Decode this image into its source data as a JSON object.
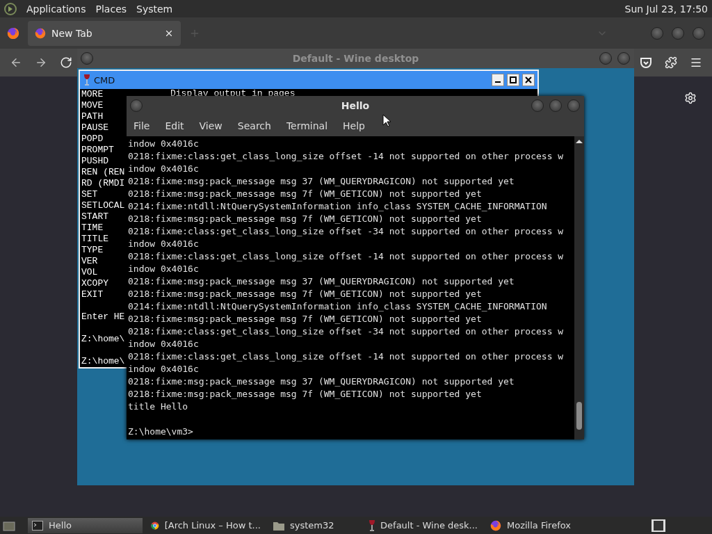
{
  "top_panel": {
    "menus": [
      "Applications",
      "Places",
      "System"
    ],
    "clock": "Sun Jul 23, 17:50"
  },
  "browser": {
    "tabs": [
      {
        "label": "New Tab",
        "selected": true
      }
    ]
  },
  "wine_desktop": {
    "title": "Default - Wine desktop"
  },
  "cmd_window": {
    "title": "CMD",
    "description": "Display output in pages",
    "lines": [
      {
        "text": "MORE",
        "gap_before": false
      },
      {
        "text": "MOVE",
        "gap_before": false
      },
      {
        "text": "PATH",
        "gap_before": false
      },
      {
        "text": "PAUSE",
        "gap_before": false
      },
      {
        "text": "POPD",
        "gap_before": false
      },
      {
        "text": "PROMPT",
        "gap_before": false
      },
      {
        "text": "PUSHD",
        "gap_before": false
      },
      {
        "text": "REN (REN",
        "gap_before": false
      },
      {
        "text": "RD (RMDI",
        "gap_before": false
      },
      {
        "text": "SET",
        "gap_before": false
      },
      {
        "text": "SETLOCAL",
        "gap_before": false
      },
      {
        "text": "START",
        "gap_before": false
      },
      {
        "text": "TIME",
        "gap_before": false
      },
      {
        "text": "TITLE",
        "gap_before": false
      },
      {
        "text": "TYPE",
        "gap_before": false
      },
      {
        "text": "VER",
        "gap_before": false
      },
      {
        "text": "VOL",
        "gap_before": false
      },
      {
        "text": "XCOPY",
        "gap_before": false
      },
      {
        "text": "EXIT",
        "gap_before": false
      },
      {
        "text": "Enter HE",
        "gap_before": true
      },
      {
        "text": "Z:\\home\\",
        "gap_before": true
      },
      {
        "text": "Z:\\home\\",
        "gap_before": true
      }
    ]
  },
  "terminal": {
    "title": "Hello",
    "menu": [
      "File",
      "Edit",
      "View",
      "Search",
      "Terminal",
      "Help"
    ],
    "lines": [
      "indow 0x4016c",
      "0218:fixme:class:get_class_long_size offset -14 not supported on other process w",
      "indow 0x4016c",
      "0218:fixme:msg:pack_message msg 37 (WM_QUERYDRAGICON) not supported yet",
      "0218:fixme:msg:pack_message msg 7f (WM_GETICON) not supported yet",
      "0214:fixme:ntdll:NtQuerySystemInformation info_class SYSTEM_CACHE_INFORMATION",
      "0218:fixme:msg:pack_message msg 7f (WM_GETICON) not supported yet",
      "0218:fixme:class:get_class_long_size offset -34 not supported on other process w",
      "indow 0x4016c",
      "0218:fixme:class:get_class_long_size offset -14 not supported on other process w",
      "indow 0x4016c",
      "0218:fixme:msg:pack_message msg 37 (WM_QUERYDRAGICON) not supported yet",
      "0218:fixme:msg:pack_message msg 7f (WM_GETICON) not supported yet",
      "0214:fixme:ntdll:NtQuerySystemInformation info_class SYSTEM_CACHE_INFORMATION",
      "0218:fixme:msg:pack_message msg 7f (WM_GETICON) not supported yet",
      "0218:fixme:class:get_class_long_size offset -34 not supported on other process w",
      "indow 0x4016c",
      "0218:fixme:class:get_class_long_size offset -14 not supported on other process w",
      "indow 0x4016c",
      "0218:fixme:msg:pack_message msg 37 (WM_QUERYDRAGICON) not supported yet",
      "0218:fixme:msg:pack_message msg 7f (WM_GETICON) not supported yet",
      "title Hello"
    ],
    "prompt": "Z:\\home\\vm3>"
  },
  "taskbar": {
    "items": [
      {
        "label": "Hello",
        "kind": "terminal",
        "selected": true
      },
      {
        "label": "[Arch Linux – How t...",
        "kind": "chrome",
        "selected": false
      },
      {
        "label": "system32",
        "kind": "folder",
        "selected": false
      },
      {
        "label": "Default - Wine desk...",
        "kind": "wine",
        "selected": false
      },
      {
        "label": "Mozilla Firefox",
        "kind": "firefox",
        "selected": false
      }
    ]
  }
}
